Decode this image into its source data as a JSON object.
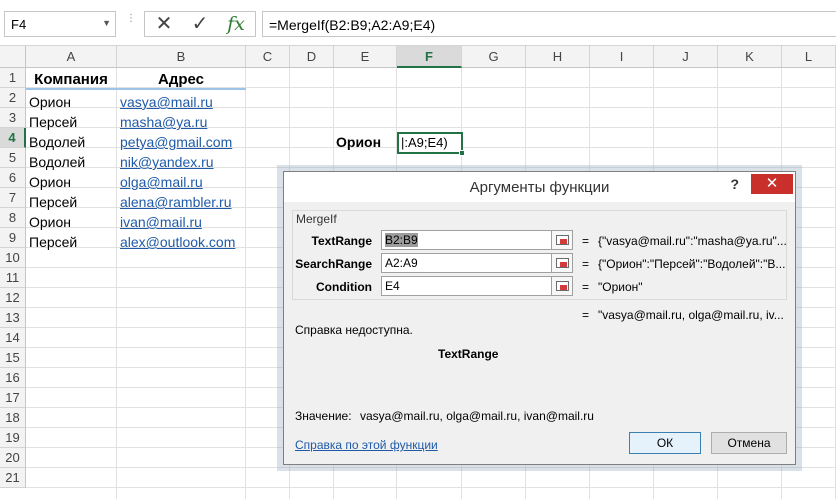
{
  "formula_bar": {
    "name_box": "F4",
    "formula": "=MergeIf(B2:B9;A2:A9;E4)",
    "icons": [
      "cancel-icon",
      "enter-icon",
      "fx-icon"
    ]
  },
  "sheet": {
    "columns": [
      "A",
      "B",
      "C",
      "D",
      "E",
      "F",
      "G",
      "H",
      "I",
      "J",
      "K",
      "L"
    ],
    "selected_column": "F",
    "rows": [
      "1",
      "2",
      "3",
      "4",
      "5",
      "6",
      "7",
      "8",
      "9",
      "10",
      "11",
      "12",
      "13",
      "14",
      "15",
      "16",
      "17",
      "18",
      "19",
      "20",
      "21"
    ],
    "selected_row": "4",
    "headers": {
      "a1": "Компания",
      "b1": "Адрес"
    },
    "data_rows": [
      {
        "company": "Орион",
        "email": "vasya@mail.ru"
      },
      {
        "company": "Персей",
        "email": "masha@ya.ru"
      },
      {
        "company": "Водолей",
        "email": "petya@gmail.com"
      },
      {
        "company": "Водолей",
        "email": "nik@yandex.ru"
      },
      {
        "company": "Орион",
        "email": "olga@mail.ru"
      },
      {
        "company": "Персей",
        "email": "alena@rambler.ru"
      },
      {
        "company": "Орион",
        "email": "ivan@mail.ru"
      },
      {
        "company": "Персей",
        "email": "alex@outlook.com"
      }
    ],
    "e4": "Орион",
    "f4_edit": "|:A9;E4)"
  },
  "dialog": {
    "title": "Аргументы функции",
    "help": "?",
    "close": "✕",
    "function_name": "MergeIf",
    "args": [
      {
        "label": "TextRange",
        "value": "B2:B9",
        "result": "{\"vasya@mail.ru\":\"masha@ya.ru\"..."
      },
      {
        "label": "SearchRange",
        "value": "A2:A9",
        "result": "{\"Орион\":\"Персей\":\"Водолей\":\"В..."
      },
      {
        "label": "Condition",
        "value": "E4",
        "result": "\"Орион\""
      }
    ],
    "equals": "=",
    "formula_result": "\"vasya@mail.ru, olga@mail.ru, iv...",
    "help_unavailable": "Справка недоступна.",
    "current_arg": "TextRange",
    "value_label": "Значение:",
    "value": "vasya@mail.ru, olga@mail.ru, ivan@mail.ru",
    "help_link": "Справка по этой функции",
    "ok": "ОК",
    "cancel": "Отмена"
  }
}
